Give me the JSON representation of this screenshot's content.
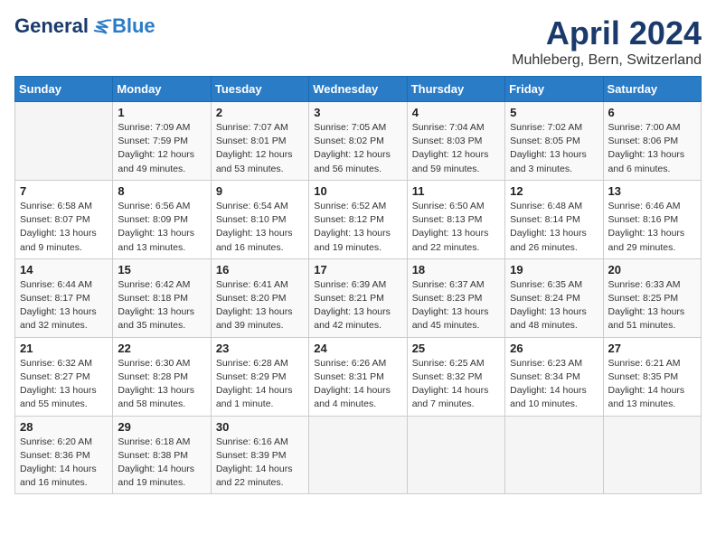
{
  "header": {
    "logo_general": "General",
    "logo_blue": "Blue",
    "month_title": "April 2024",
    "location": "Muhleberg, Bern, Switzerland"
  },
  "days_of_week": [
    "Sunday",
    "Monday",
    "Tuesday",
    "Wednesday",
    "Thursday",
    "Friday",
    "Saturday"
  ],
  "weeks": [
    [
      {
        "day": "",
        "content": ""
      },
      {
        "day": "1",
        "content": "Sunrise: 7:09 AM\nSunset: 7:59 PM\nDaylight: 12 hours\nand 49 minutes."
      },
      {
        "day": "2",
        "content": "Sunrise: 7:07 AM\nSunset: 8:01 PM\nDaylight: 12 hours\nand 53 minutes."
      },
      {
        "day": "3",
        "content": "Sunrise: 7:05 AM\nSunset: 8:02 PM\nDaylight: 12 hours\nand 56 minutes."
      },
      {
        "day": "4",
        "content": "Sunrise: 7:04 AM\nSunset: 8:03 PM\nDaylight: 12 hours\nand 59 minutes."
      },
      {
        "day": "5",
        "content": "Sunrise: 7:02 AM\nSunset: 8:05 PM\nDaylight: 13 hours\nand 3 minutes."
      },
      {
        "day": "6",
        "content": "Sunrise: 7:00 AM\nSunset: 8:06 PM\nDaylight: 13 hours\nand 6 minutes."
      }
    ],
    [
      {
        "day": "7",
        "content": "Sunrise: 6:58 AM\nSunset: 8:07 PM\nDaylight: 13 hours\nand 9 minutes."
      },
      {
        "day": "8",
        "content": "Sunrise: 6:56 AM\nSunset: 8:09 PM\nDaylight: 13 hours\nand 13 minutes."
      },
      {
        "day": "9",
        "content": "Sunrise: 6:54 AM\nSunset: 8:10 PM\nDaylight: 13 hours\nand 16 minutes."
      },
      {
        "day": "10",
        "content": "Sunrise: 6:52 AM\nSunset: 8:12 PM\nDaylight: 13 hours\nand 19 minutes."
      },
      {
        "day": "11",
        "content": "Sunrise: 6:50 AM\nSunset: 8:13 PM\nDaylight: 13 hours\nand 22 minutes."
      },
      {
        "day": "12",
        "content": "Sunrise: 6:48 AM\nSunset: 8:14 PM\nDaylight: 13 hours\nand 26 minutes."
      },
      {
        "day": "13",
        "content": "Sunrise: 6:46 AM\nSunset: 8:16 PM\nDaylight: 13 hours\nand 29 minutes."
      }
    ],
    [
      {
        "day": "14",
        "content": "Sunrise: 6:44 AM\nSunset: 8:17 PM\nDaylight: 13 hours\nand 32 minutes."
      },
      {
        "day": "15",
        "content": "Sunrise: 6:42 AM\nSunset: 8:18 PM\nDaylight: 13 hours\nand 35 minutes."
      },
      {
        "day": "16",
        "content": "Sunrise: 6:41 AM\nSunset: 8:20 PM\nDaylight: 13 hours\nand 39 minutes."
      },
      {
        "day": "17",
        "content": "Sunrise: 6:39 AM\nSunset: 8:21 PM\nDaylight: 13 hours\nand 42 minutes."
      },
      {
        "day": "18",
        "content": "Sunrise: 6:37 AM\nSunset: 8:23 PM\nDaylight: 13 hours\nand 45 minutes."
      },
      {
        "day": "19",
        "content": "Sunrise: 6:35 AM\nSunset: 8:24 PM\nDaylight: 13 hours\nand 48 minutes."
      },
      {
        "day": "20",
        "content": "Sunrise: 6:33 AM\nSunset: 8:25 PM\nDaylight: 13 hours\nand 51 minutes."
      }
    ],
    [
      {
        "day": "21",
        "content": "Sunrise: 6:32 AM\nSunset: 8:27 PM\nDaylight: 13 hours\nand 55 minutes."
      },
      {
        "day": "22",
        "content": "Sunrise: 6:30 AM\nSunset: 8:28 PM\nDaylight: 13 hours\nand 58 minutes."
      },
      {
        "day": "23",
        "content": "Sunrise: 6:28 AM\nSunset: 8:29 PM\nDaylight: 14 hours\nand 1 minute."
      },
      {
        "day": "24",
        "content": "Sunrise: 6:26 AM\nSunset: 8:31 PM\nDaylight: 14 hours\nand 4 minutes."
      },
      {
        "day": "25",
        "content": "Sunrise: 6:25 AM\nSunset: 8:32 PM\nDaylight: 14 hours\nand 7 minutes."
      },
      {
        "day": "26",
        "content": "Sunrise: 6:23 AM\nSunset: 8:34 PM\nDaylight: 14 hours\nand 10 minutes."
      },
      {
        "day": "27",
        "content": "Sunrise: 6:21 AM\nSunset: 8:35 PM\nDaylight: 14 hours\nand 13 minutes."
      }
    ],
    [
      {
        "day": "28",
        "content": "Sunrise: 6:20 AM\nSunset: 8:36 PM\nDaylight: 14 hours\nand 16 minutes."
      },
      {
        "day": "29",
        "content": "Sunrise: 6:18 AM\nSunset: 8:38 PM\nDaylight: 14 hours\nand 19 minutes."
      },
      {
        "day": "30",
        "content": "Sunrise: 6:16 AM\nSunset: 8:39 PM\nDaylight: 14 hours\nand 22 minutes."
      },
      {
        "day": "",
        "content": ""
      },
      {
        "day": "",
        "content": ""
      },
      {
        "day": "",
        "content": ""
      },
      {
        "day": "",
        "content": ""
      }
    ]
  ]
}
